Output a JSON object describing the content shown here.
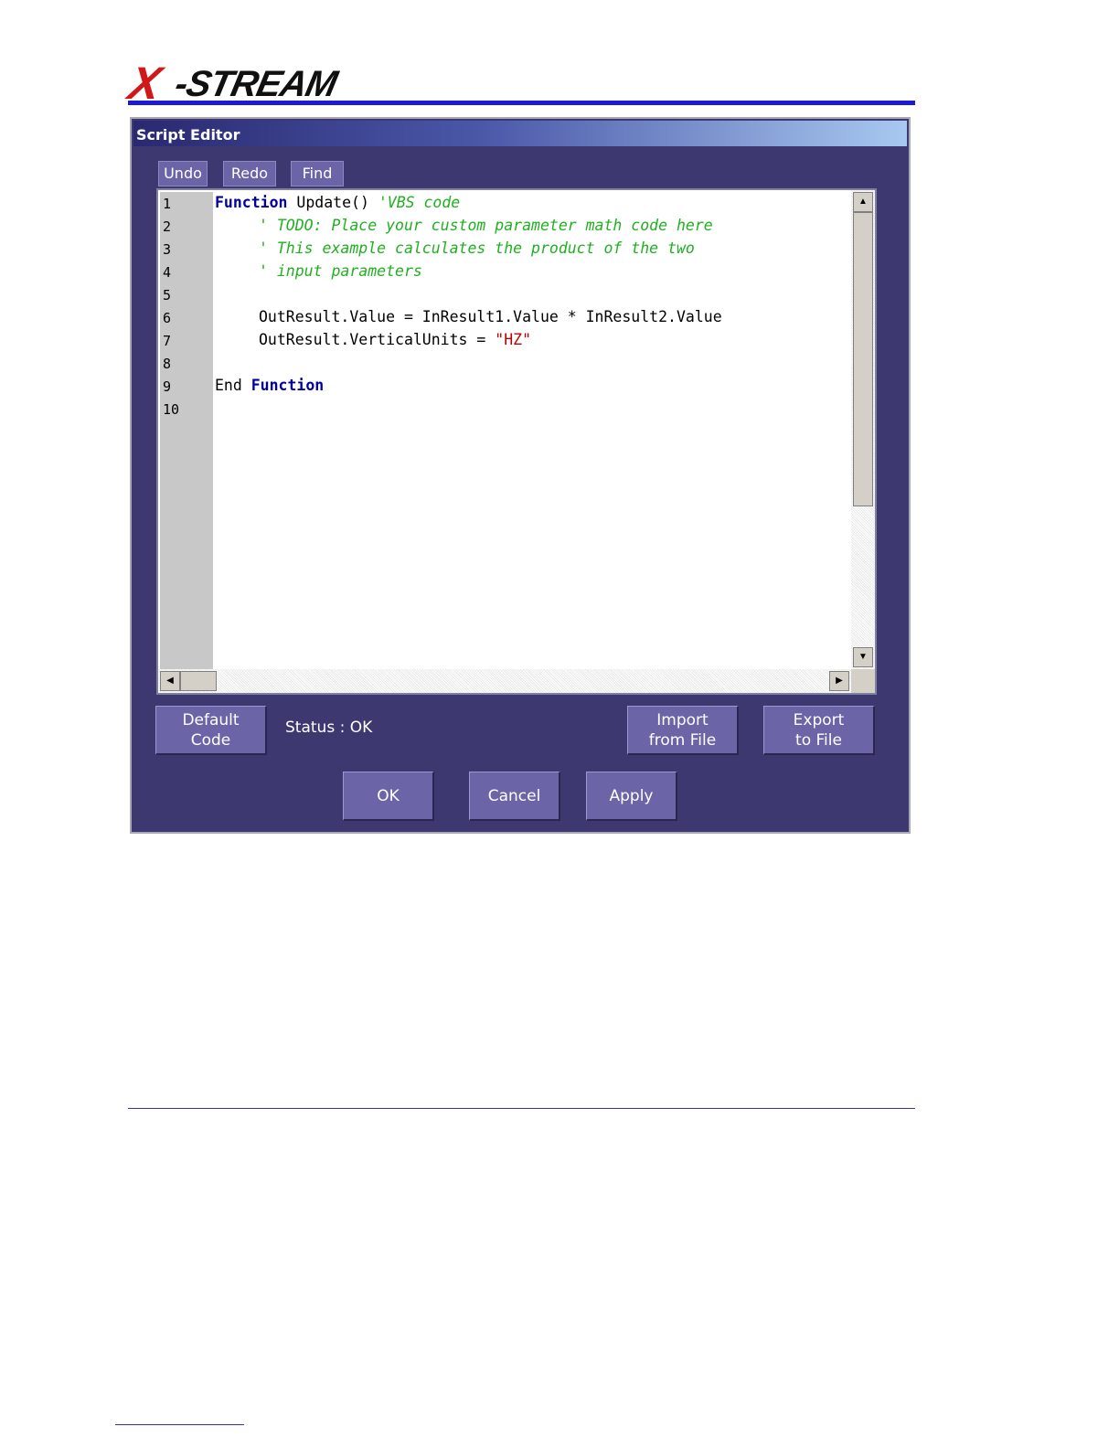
{
  "logo": {
    "text_x": "X",
    "text_rest": "-STREAM"
  },
  "window": {
    "title": "Script Editor"
  },
  "toolbar": {
    "undo": "Undo",
    "redo": "Redo",
    "find": "Find"
  },
  "editor": {
    "line_numbers": [
      "1",
      "2",
      "3",
      "4",
      "5",
      "6",
      "7",
      "8",
      "9",
      "10"
    ],
    "lines": {
      "l1_kw": "Function",
      "l1_text": " Update() ",
      "l1_comment": "'VBS code",
      "l2_comment": "' TODO: Place your custom parameter math code here",
      "l3_comment": "' This example calculates the product of the two",
      "l4_comment": "' input parameters",
      "l6_text": "OutResult.Value = InResult1.Value * InResult2.Value",
      "l7_text": "OutResult.VerticalUnits = ",
      "l7_string": "\"HZ\"",
      "l9_text": "End ",
      "l9_kw": "Function"
    }
  },
  "buttons": {
    "default_code": [
      "Default",
      "Code"
    ],
    "import_from_file": [
      "Import",
      "from File"
    ],
    "export_to_file": [
      "Export",
      "to File"
    ],
    "ok": "OK",
    "cancel": "Cancel",
    "apply": "Apply"
  },
  "status": "Status : OK"
}
